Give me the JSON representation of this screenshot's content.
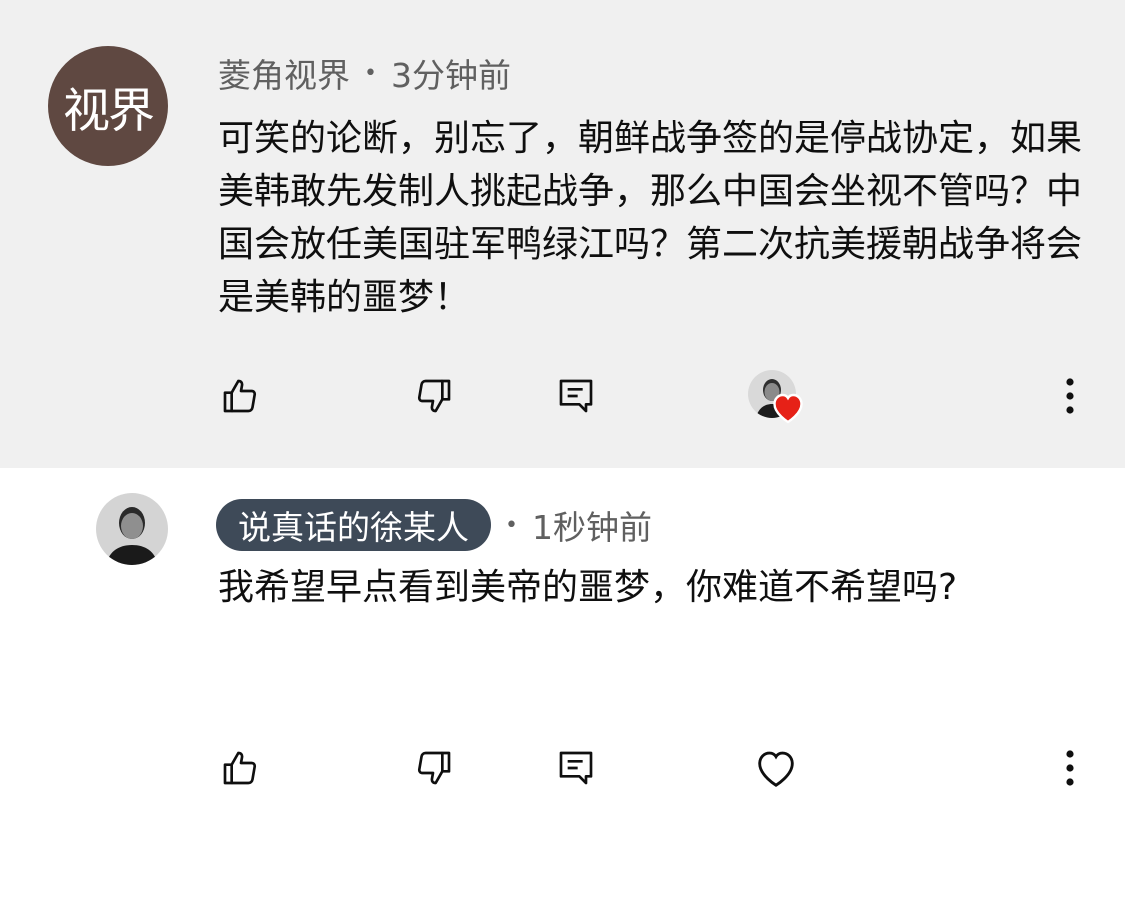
{
  "comments": [
    {
      "author": "菱角视界",
      "avatar_text": "视界",
      "dot": "•",
      "time": "3分钟前",
      "text": "可笑的论断，别忘了，朝鲜战争签的是停战协定，如果美韩敢先发制人挑起战争，那么中国会坐视不管吗？中国会放任美国驻军鸭绿江吗？第二次抗美援朝战争将会是美韩的噩梦！",
      "actions": [
        "thumb-up-icon",
        "thumb-down-icon",
        "reply-icon",
        "creator-heart-icon",
        "more-vert-icon"
      ]
    },
    {
      "author": "说真话的徐某人",
      "dot": "•",
      "time": "1秒钟前",
      "text": "我希望早点看到美帝的噩梦，你难道不希望吗?",
      "actions": [
        "thumb-up-icon",
        "thumb-down-icon",
        "reply-icon",
        "heart-outline-icon",
        "more-vert-icon"
      ]
    }
  ],
  "colors": {
    "highlight_bg": "#f0f0f0",
    "avatar_bg": "#5f4841",
    "author_chip_bg": "#3e4a58",
    "meta_text": "#606060",
    "heart_red": "#e62117"
  }
}
